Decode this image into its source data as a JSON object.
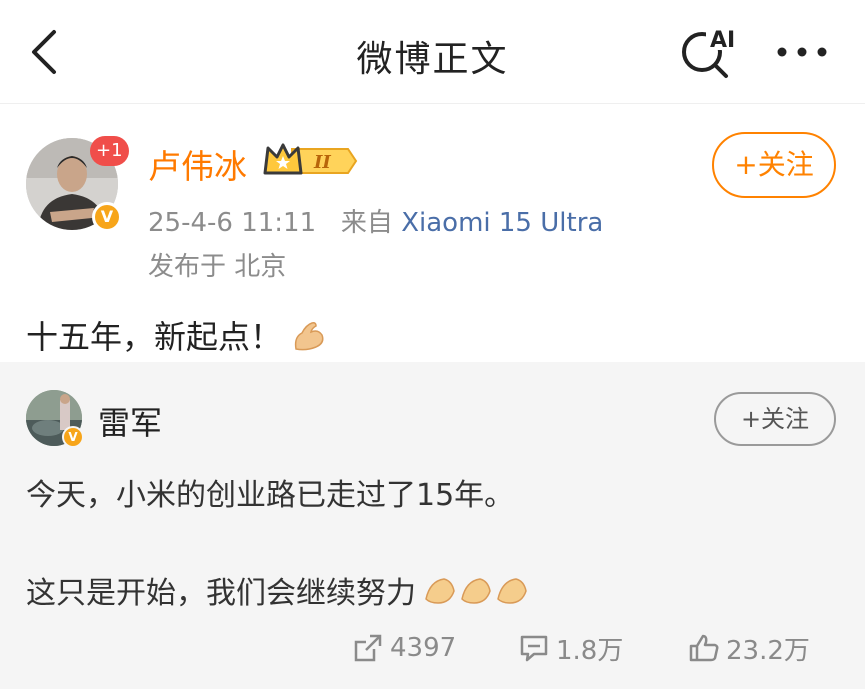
{
  "header": {
    "title": "微博正文",
    "ai_label": "AI"
  },
  "post": {
    "author": "卢伟冰",
    "plus_badge": "+1",
    "v_label": "V",
    "level_label": "II",
    "time": "25-4-6 11:11",
    "source_prefix": "来自",
    "source": "Xiaomi 15 Ultra",
    "location": "发布于 北京",
    "follow_label": "+关注",
    "text": "十五年，新起点！"
  },
  "repost": {
    "author": "雷军",
    "v_label": "V",
    "follow_label": "+关注",
    "line1": "今天，小米的创业路已走过了15年。",
    "line2": "这只是开始，我们会继续努力",
    "stats": {
      "reposts": "4397",
      "comments": "1.8万",
      "likes": "23.2万"
    }
  },
  "colors": {
    "accent_orange": "#ff8200",
    "author_orange": "#ff7a00",
    "source_blue": "#4a6ea8",
    "badge_red": "#f04e4a",
    "badge_gold": "#f7a51a"
  }
}
